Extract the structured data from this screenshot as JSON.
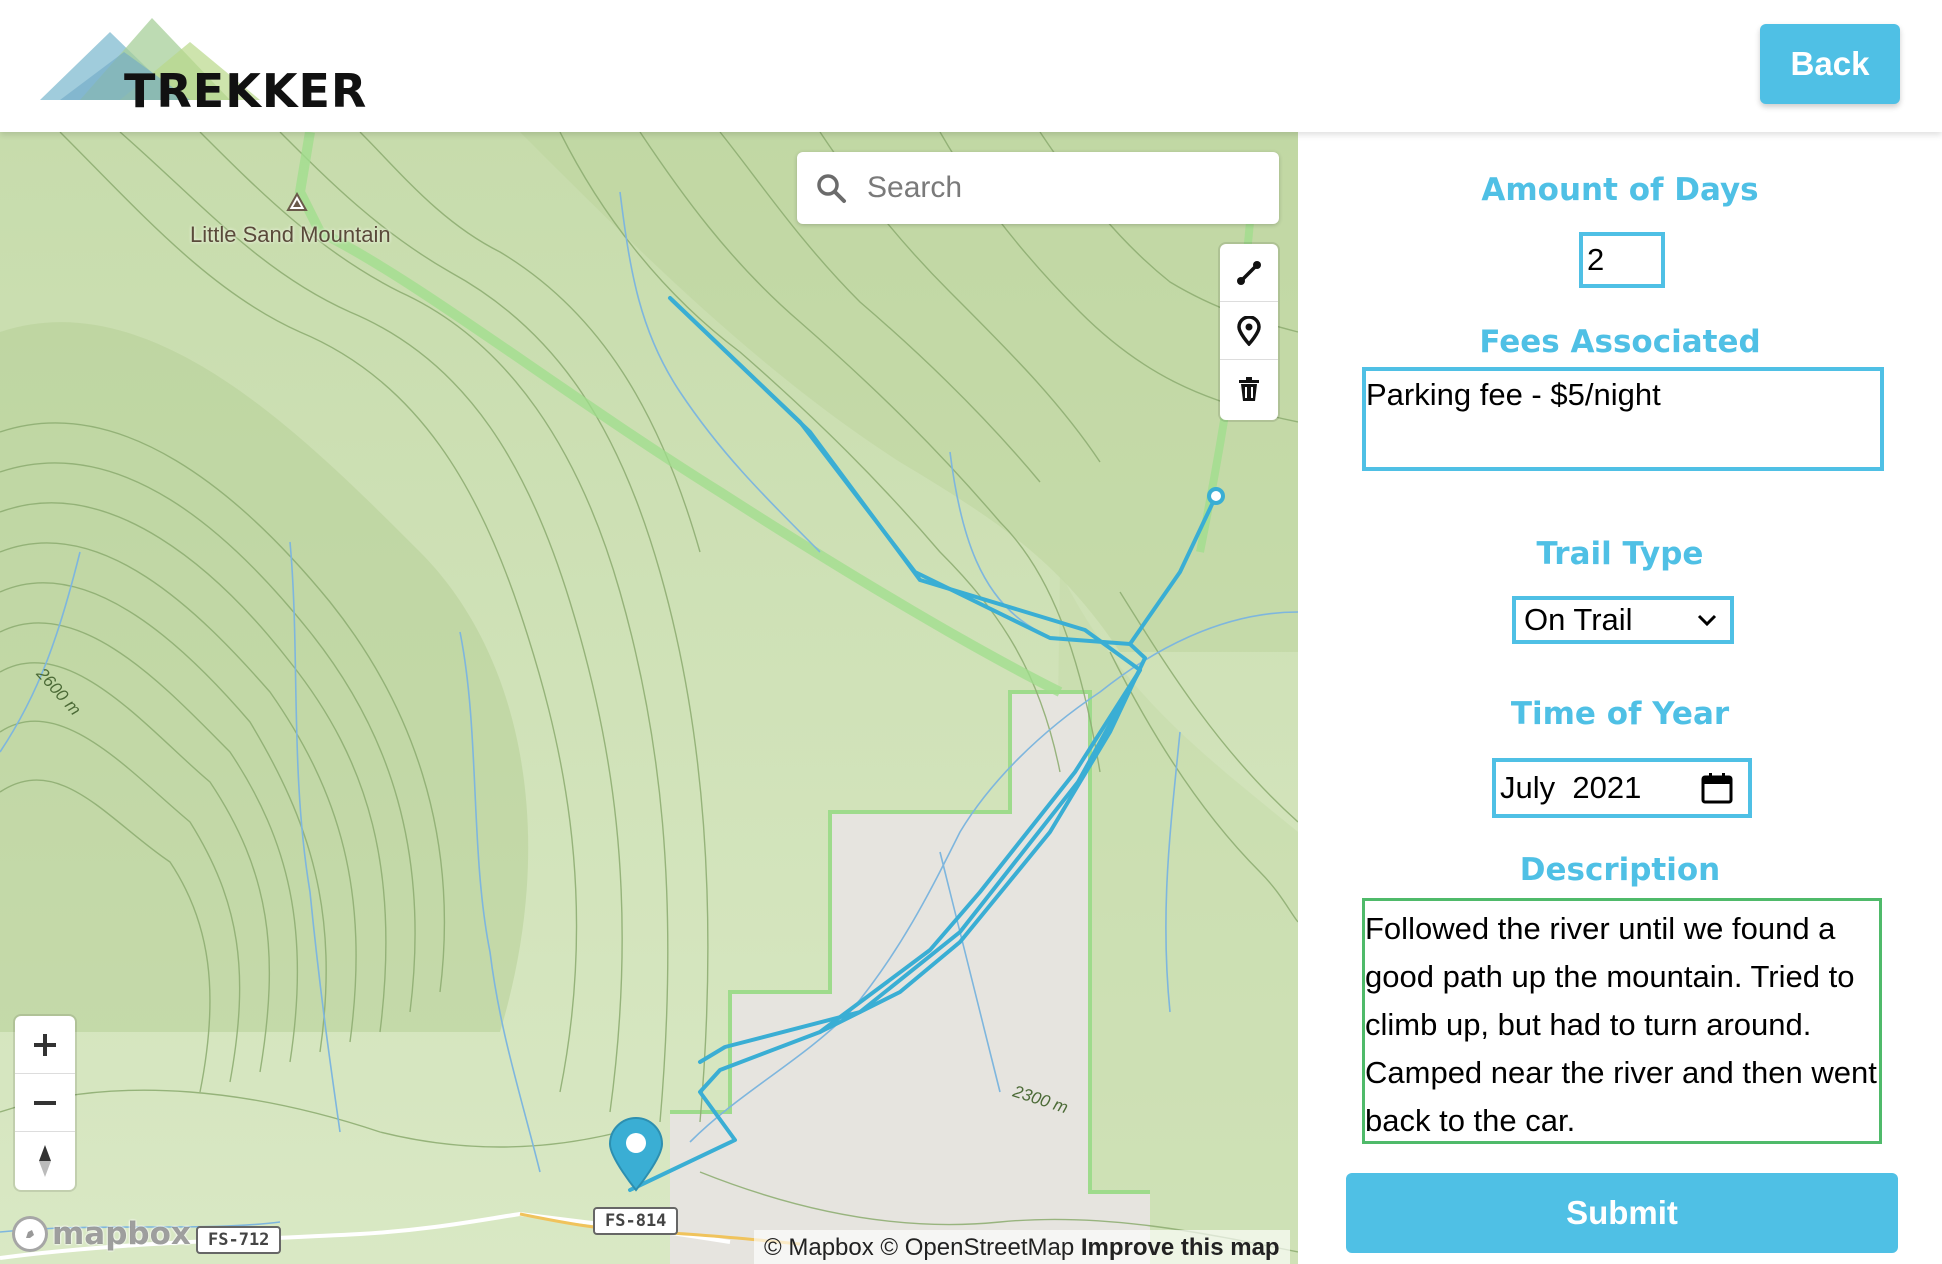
{
  "app": {
    "logo_text": "TREKKER",
    "back_label": "Back"
  },
  "map": {
    "search_placeholder": "Search",
    "peak_label": "Little Sand Mountain",
    "contour_labels": [
      "2600 m",
      "2300 m"
    ],
    "road_shields": [
      "FS-712",
      "FS-814"
    ],
    "mapbox_wordmark": "mapbox",
    "attribution": {
      "mapbox": "© Mapbox",
      "osm": "© OpenStreetMap",
      "improve": "Improve this map"
    },
    "draw_tools": [
      "line-tool-icon",
      "point-tool-icon",
      "trash-icon"
    ],
    "nav_controls": [
      "zoom-in-icon",
      "zoom-out-icon",
      "compass-icon"
    ],
    "route_color": "#3aaed4"
  },
  "form": {
    "days_label": "Amount of Days",
    "days_value": "2",
    "fees_label": "Fees Associated",
    "fees_value": "Parking fee - $5/night",
    "trail_type_label": "Trail Type",
    "trail_type_value": "On Trail",
    "time_label": "Time of Year",
    "time_month": "July",
    "time_year": "2021",
    "description_label": "Description",
    "description_value": "Followed the river until we found a good path up the mountain. Tried to climb up, but had to turn around. Camped near the river and then went back to the car.",
    "submit_label": "Submit"
  },
  "colors": {
    "accent": "#4fc0e5",
    "focus_border": "#4fba6a",
    "map_base": "#cfe1b4"
  }
}
